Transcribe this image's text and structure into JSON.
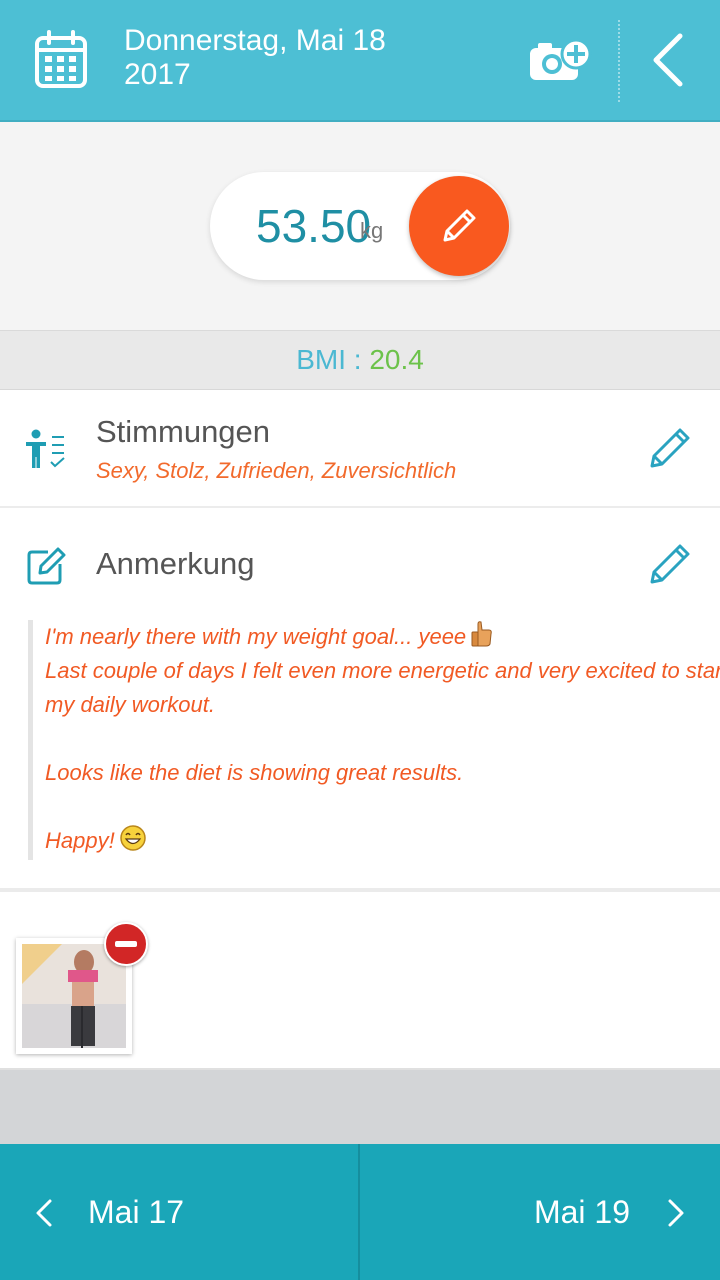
{
  "header": {
    "date_line1": "Donnerstag, Mai 18",
    "date_line2": "2017"
  },
  "weight": {
    "value": "53.50",
    "unit": "kg"
  },
  "bmi": {
    "label": "BMI : ",
    "value": "20.4"
  },
  "mood": {
    "title": "Stimmungen",
    "values": "Sexy, Stolz, Zufrieden, Zuversichtlich"
  },
  "note": {
    "title": "Anmerkung",
    "lines": [
      "I'm nearly there with my weight goal... yeee",
      "Last couple of days I felt even more energetic and very excited to start",
      "my daily workout.",
      "Looks like the diet is showing great results.",
      "Happy!"
    ]
  },
  "nav": {
    "prev_label": "Mai 17",
    "next_label": "Mai 19"
  },
  "colors": {
    "header": "#4dbfd4",
    "accent_orange": "#f9591f",
    "note_text": "#f15a24",
    "bmi_value": "#6cc24a",
    "bottom_nav": "#1aa6b8"
  },
  "icons": [
    "calendar-icon",
    "camera-add-icon",
    "back-chevron-icon",
    "pencil-icon",
    "person-checklist-icon",
    "note-edit-icon",
    "thumbs-up-emoji",
    "laughing-emoji",
    "minus-icon",
    "chevron-left-icon",
    "chevron-right-icon"
  ]
}
